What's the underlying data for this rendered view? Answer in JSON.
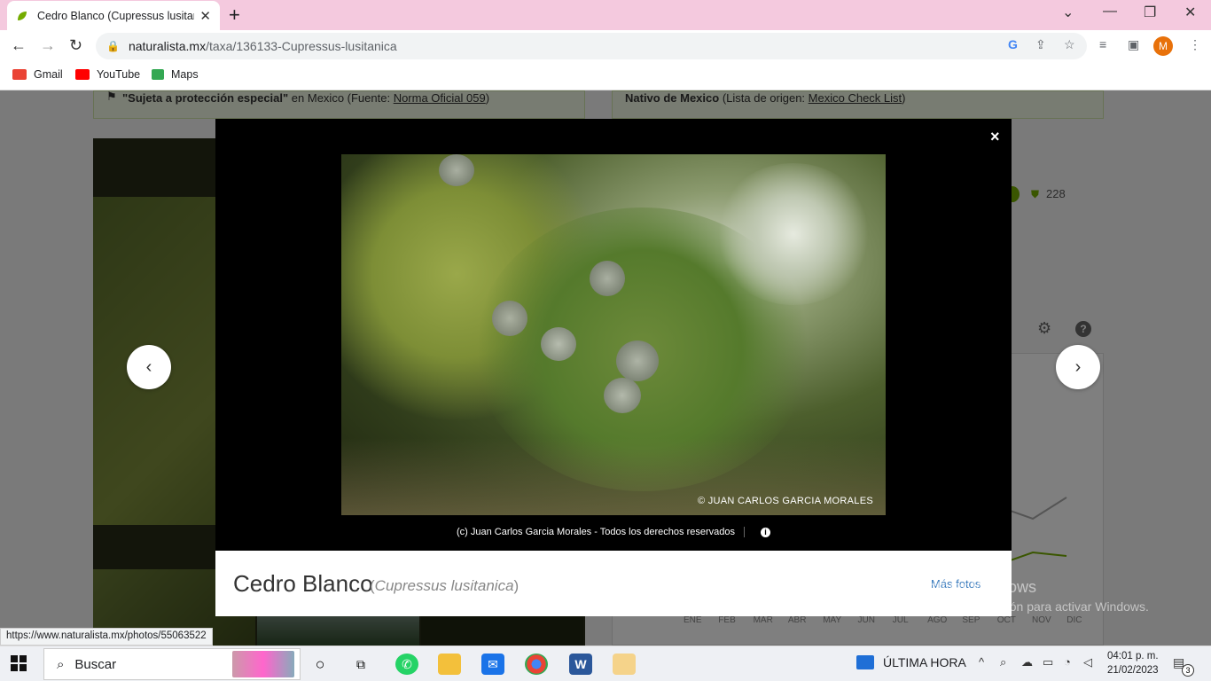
{
  "browser": {
    "tab_title": "Cedro Blanco (Cupressus lusitanica",
    "tab_close": "✕",
    "new_tab": "+",
    "url_host": "naturalista.mx",
    "url_path": "/taxa/136133-Cupressus-lusitanica",
    "avatar_letter": "M",
    "bookmarks": [
      "Gmail",
      "YouTube",
      "Maps"
    ]
  },
  "page": {
    "status_left_quote": "\"Sujeta a protección especial\"",
    "status_left_rest": " en Mexico (Fuente: ",
    "status_left_link": "Norma Oficial 059",
    "status_left_end": ")",
    "status_right_bold": "Nativo de Mexico",
    "status_right_rest": " (Lista de origen: ",
    "status_right_link": "Mexico Check List",
    "status_right_end": ")",
    "obs_count": "228",
    "months": [
      "ENE",
      "FEB",
      "MAR",
      "ABR",
      "MAY",
      "JUN",
      "JUL",
      "AGO",
      "SEP",
      "OCT",
      "NOV",
      "DIC"
    ]
  },
  "modal": {
    "close": "×",
    "prev": "‹",
    "next": "›",
    "watermark": "© JUAN CARLOS GARCIA MORALES",
    "caption": "(c) Juan Carlos Garcia Morales - Todos los derechos reservados",
    "info": "i",
    "common_name": "Cedro Blanco",
    "sci_open": "(",
    "sci_name": "Cupressus lusitanica",
    "sci_close": ")",
    "more_photos": "Más fotos"
  },
  "windows_watermark": {
    "line1": "Activar Windows",
    "line2": "Ve a Configuración para activar Windows."
  },
  "status_url": "https://www.naturalista.mx/photos/55063522",
  "taskbar": {
    "search_placeholder": "Buscar",
    "news": "ÚLTIMA HORA",
    "time": "04:01 p. m.",
    "date": "21/02/2023",
    "notifications": "3"
  },
  "colors": {
    "tabbar": "#f4c9de",
    "accent_link": "#3a7bbd",
    "status_green_bg": "#f1f8e4",
    "avatar": "#e8710a"
  }
}
